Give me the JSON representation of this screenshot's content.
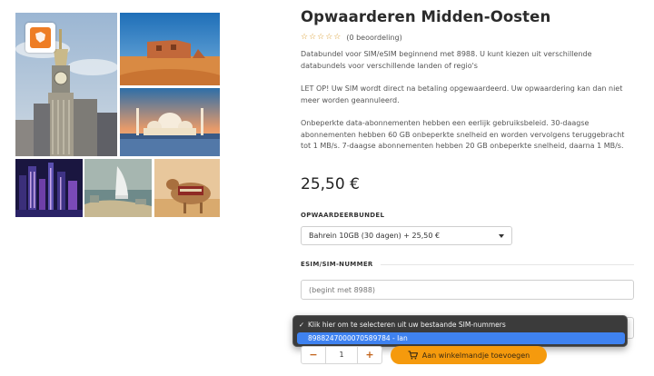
{
  "product": {
    "title": "Opwaarderen Midden-Oosten",
    "rating_stars": "☆☆☆☆☆",
    "review_count": "(0 beoordeling)",
    "description_1": "Databundel voor SIM/eSIM beginnend met 8988. U kunt kiezen uit verschillende databundels voor verschillende landen of regio's",
    "description_2": "LET OP! Uw SIM wordt direct na betaling opgewaardeerd. Uw opwaardering kan dan niet meer worden geannuleerd.",
    "description_3": "Onbeperkte data-abonnementen hebben een eerlijk gebruiksbeleid. 30-daagse abonnementen hebben 60 GB onbeperkte snelheid en worden vervolgens teruggebracht tot 1 MB/s. 7-daagse abonnementen hebben 20 GB onbeperkte snelheid, daarna 1 MB/s.",
    "price": "25,50 €"
  },
  "form": {
    "bundle_label": "OPWAARDEERBUNDEL",
    "bundle_selected": "Bahrein 10GB (30 dagen) + 25,50 €",
    "sim_label": "ESIM/SIM-NUMMER",
    "sim_placeholder": "(begint met 8988)",
    "dropdown_options": [
      {
        "check": "✓",
        "label": "Klik hier om te selecteren uit uw bestaande SIM-nummers"
      },
      {
        "check": "",
        "label": "8988247000070589784 - Ian"
      }
    ],
    "quantity": "1",
    "minus_label": "−",
    "plus_label": "+",
    "add_to_cart_label": "Aan winkelmandje toevoegen"
  },
  "gallery": {
    "images": [
      "mecca-clock-tower",
      "desert-ruins",
      "abu-dhabi-mosque",
      "dubai-skyline-night",
      "burj-al-arab",
      "camel"
    ]
  },
  "colors": {
    "accent": "#f59a0d",
    "accent_text": "#c2621a",
    "selected_option": "#3f82f0",
    "logo_orange": "#ee7d24"
  }
}
